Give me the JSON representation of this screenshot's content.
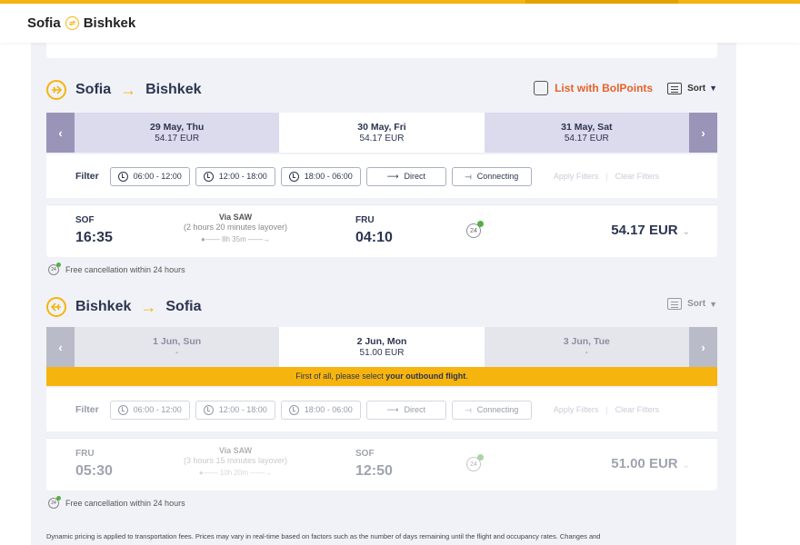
{
  "header": {
    "origin": "Sofia",
    "destination": "Bishkek"
  },
  "outbound": {
    "origin": "Sofia",
    "destination": "Bishkek",
    "bolpoints_label": "List with BolPoints",
    "sort_label": "Sort",
    "dates": [
      {
        "date": "29 May, Thu",
        "price": "54.17 EUR"
      },
      {
        "date": "30 May, Fri",
        "price": "54.17 EUR"
      },
      {
        "date": "31 May, Sat",
        "price": "54.17 EUR"
      }
    ],
    "filter": {
      "label": "Filter",
      "time1": "06:00 - 12:00",
      "time2": "12:00 - 18:00",
      "time3": "18:00 - 06:00",
      "direct": "Direct",
      "connecting": "Connecting",
      "apply": "Apply Filters",
      "clear": "Clear Filters"
    },
    "flight": {
      "from_code": "SOF",
      "from_time": "16:35",
      "via": "Via SAW",
      "layover": "(2 hours 20 minutes layover)",
      "duration": "8h 35m",
      "to_code": "FRU",
      "to_time": "04:10",
      "badge": "24",
      "price": "54.17 EUR"
    },
    "cancellation": "Free cancellation within 24 hours"
  },
  "inbound": {
    "origin": "Bishkek",
    "destination": "Sofia",
    "sort_label": "Sort",
    "dates": [
      {
        "date": "1 Jun, Sun",
        "price": "-"
      },
      {
        "date": "2 Jun, Mon",
        "price": "51.00 EUR"
      },
      {
        "date": "3 Jun, Tue",
        "price": "-"
      }
    ],
    "notice_prefix": "First of all, please select ",
    "notice_bold": "your outbound flight",
    "notice_suffix": ".",
    "filter": {
      "label": "Filter",
      "time1": "06:00 - 12:00",
      "time2": "12:00 - 18:00",
      "time3": "18:00 - 06:00",
      "direct": "Direct",
      "connecting": "Connecting",
      "apply": "Apply Filters",
      "clear": "Clear Filters"
    },
    "flight": {
      "from_code": "FRU",
      "from_time": "05:30",
      "via": "Via SAW",
      "layover": "(3 hours 15 minutes layover)",
      "duration": "10h 20m",
      "to_code": "SOF",
      "to_time": "12:50",
      "badge": "24",
      "price": "51.00 EUR"
    },
    "cancellation": "Free cancellation within 24 hours"
  },
  "footnote": "Dynamic pricing is applied to transportation fees. Prices may vary in real-time based on factors such as the number of days remaining until the flight and occupancy rates. Changes and",
  "colors": {
    "accent": "#f6b40e",
    "bolpoints": "#e6622b",
    "selected_date_bar": "#dcdaed"
  }
}
